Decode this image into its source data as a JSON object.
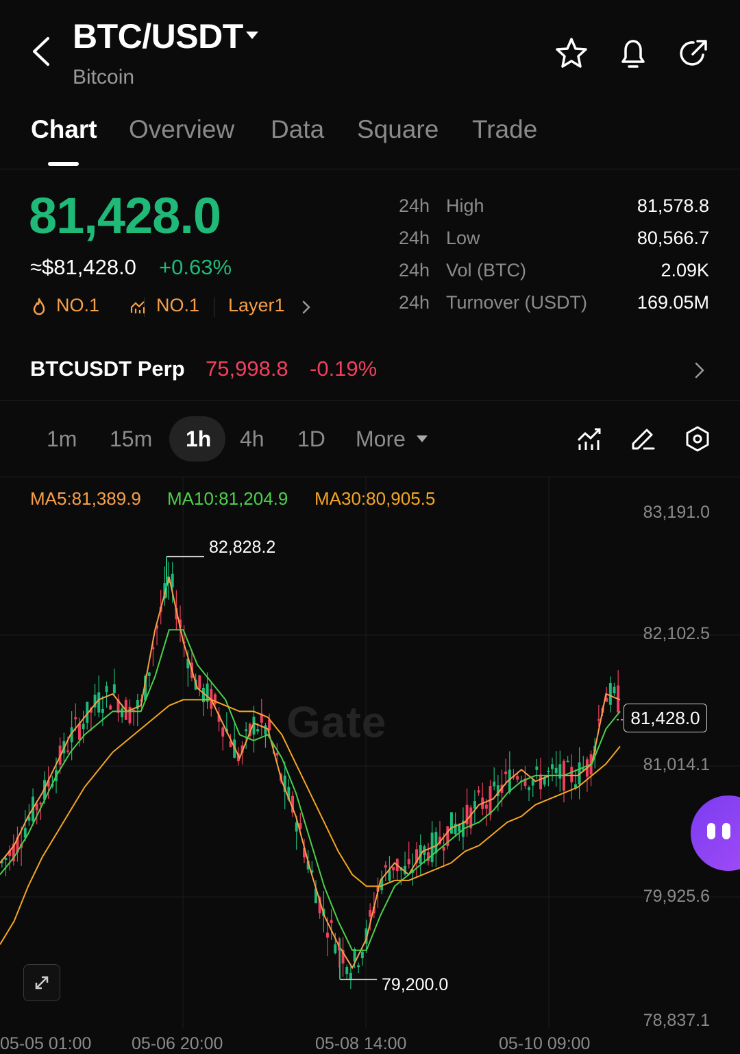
{
  "header": {
    "pair": "BTC/USDT",
    "name": "Bitcoin",
    "icons": [
      "back-arrow-icon",
      "star-icon",
      "bell-icon",
      "share-icon"
    ]
  },
  "tabs": [
    "Chart",
    "Overview",
    "Data",
    "Square",
    "Trade"
  ],
  "active_tab": "Chart",
  "ticker": {
    "price": "81,428.0",
    "approx_usd": "≈$81,428.0",
    "change_pct": "+0.63%",
    "tag_hot": "NO.1",
    "tag_rank": "NO.1",
    "tag_sector": "Layer1",
    "stats": [
      {
        "period": "24h",
        "label": "High",
        "value": "81,578.8"
      },
      {
        "period": "24h",
        "label": "Low",
        "value": "80,566.7"
      },
      {
        "period": "24h",
        "label": "Vol (BTC)",
        "value": "2.09K"
      },
      {
        "period": "24h",
        "label": "Turnover (USDT)",
        "value": "169.05M"
      }
    ]
  },
  "perp": {
    "name": "BTCUSDT Perp",
    "price": "75,998.8",
    "change": "-0.19%"
  },
  "intervals": [
    "1m",
    "15m",
    "1h",
    "4h",
    "1D",
    "More"
  ],
  "active_interval": "1h",
  "indicators": {
    "ma5": "MA5:81,389.9",
    "ma10": "MA10:81,204.9",
    "ma30": "MA30:80,905.5"
  },
  "colors": {
    "up": "#1fb978",
    "down": "#f0405e",
    "ma5": "#f7a04a",
    "ma10": "#4cd04c",
    "ma30": "#f5a623"
  },
  "watermark": "Gate",
  "chart_data": {
    "type": "candlestick",
    "interval": "1h",
    "y_ticks": [
      "83,191.0",
      "82,102.5",
      "81,014.1",
      "79,925.6",
      "78,837.1"
    ],
    "x_ticks": [
      "05-05 01:00",
      "05-06 20:00",
      "05-08 14:00",
      "05-10 09:00"
    ],
    "ylim": [
      78837.1,
      83191.0
    ],
    "current_price": "81,428.0",
    "max_label": "82,828.2",
    "min_label": "79,200.0",
    "series": [
      {
        "name": "MA5",
        "values": [
          80200,
          80350,
          80600,
          80800,
          81050,
          81300,
          81450,
          81600,
          81650,
          81500,
          81550,
          82200,
          82650,
          82100,
          81700,
          81600,
          81350,
          81100,
          81400,
          81350,
          80900,
          80600,
          80150,
          79750,
          79500,
          79300,
          79550,
          80050,
          80200,
          80100,
          80300,
          80350,
          80500,
          80550,
          80700,
          80750,
          80900,
          81000,
          80900,
          80950,
          80950,
          80950,
          81050,
          81650,
          81600
        ]
      },
      {
        "name": "MA10",
        "values": [
          80100,
          80250,
          80450,
          80700,
          80950,
          81150,
          81300,
          81400,
          81500,
          81500,
          81500,
          81800,
          82200,
          82200,
          81900,
          81750,
          81600,
          81300,
          81250,
          81300,
          81100,
          80800,
          80400,
          80000,
          79700,
          79450,
          79450,
          79750,
          80000,
          80100,
          80200,
          80300,
          80400,
          80500,
          80550,
          80650,
          80800,
          80900,
          80950,
          80950,
          80950,
          81000,
          81050,
          81350,
          81500
        ]
      },
      {
        "name": "MA30",
        "values": [
          79500,
          79700,
          80000,
          80250,
          80450,
          80650,
          80850,
          81000,
          81150,
          81250,
          81350,
          81450,
          81550,
          81600,
          81600,
          81600,
          81550,
          81500,
          81500,
          81450,
          81300,
          81050,
          80800,
          80550,
          80300,
          80100,
          80000,
          80000,
          80050,
          80050,
          80100,
          80150,
          80200,
          80300,
          80350,
          80450,
          80550,
          80600,
          80700,
          80750,
          80800,
          80850,
          80950,
          81050,
          81200
        ]
      }
    ]
  }
}
